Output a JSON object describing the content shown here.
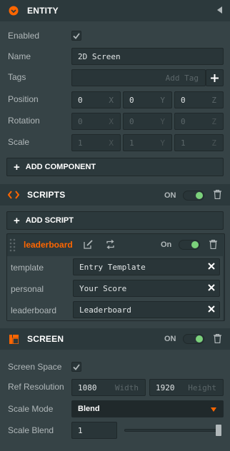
{
  "entity": {
    "title": "ENTITY",
    "enabled_label": "Enabled",
    "enabled": true,
    "name_label": "Name",
    "name_value": "2D Screen",
    "tags_label": "Tags",
    "tags_placeholder": "Add Tag",
    "position_label": "Position",
    "position": {
      "x": "0",
      "y": "0",
      "z": "0"
    },
    "rotation_label": "Rotation",
    "rotation": {
      "x": "0",
      "y": "0",
      "z": "0"
    },
    "scale_label": "Scale",
    "scale": {
      "x": "1",
      "y": "1",
      "z": "1"
    },
    "axis": {
      "x": "X",
      "y": "Y",
      "z": "Z"
    },
    "add_component_label": "ADD COMPONENT"
  },
  "scripts": {
    "title": "SCRIPTS",
    "on_label": "ON",
    "add_script_label": "ADD SCRIPT",
    "script": {
      "name": "leaderboard",
      "on_label": "On",
      "attributes": [
        {
          "label": "template",
          "value": "Entry Template"
        },
        {
          "label": "personal",
          "value": "Your Score"
        },
        {
          "label": "leaderboard",
          "value": "Leaderboard"
        }
      ]
    }
  },
  "screen": {
    "title": "SCREEN",
    "on_label": "ON",
    "screen_space_label": "Screen Space",
    "screen_space": true,
    "ref_resolution_label": "Ref Resolution",
    "ref_width": "1080",
    "width_label": "Width",
    "ref_height": "1920",
    "height_label": "Height",
    "scale_mode_label": "Scale Mode",
    "scale_mode_value": "Blend",
    "scale_blend_label": "Scale Blend",
    "scale_blend_value": "1",
    "scale_blend_fraction": 1.0
  },
  "colors": {
    "accent_orange": "#ff6600",
    "toggle_on": "#7bd17b",
    "panel_bg": "#364346",
    "header_bg": "#2c393c"
  },
  "icons": {
    "entity": "entity-icon",
    "collapse": "collapse-arrow-icon",
    "scripts": "code-brackets-icon",
    "screen": "screen-layout-icon",
    "trash": "trash-icon",
    "edit": "edit-icon",
    "refresh": "refresh-icon",
    "drag": "drag-handle-icon",
    "clear": "close-icon",
    "plus": "plus-icon",
    "check": "check-icon",
    "dropdown": "dropdown-arrow-icon"
  }
}
